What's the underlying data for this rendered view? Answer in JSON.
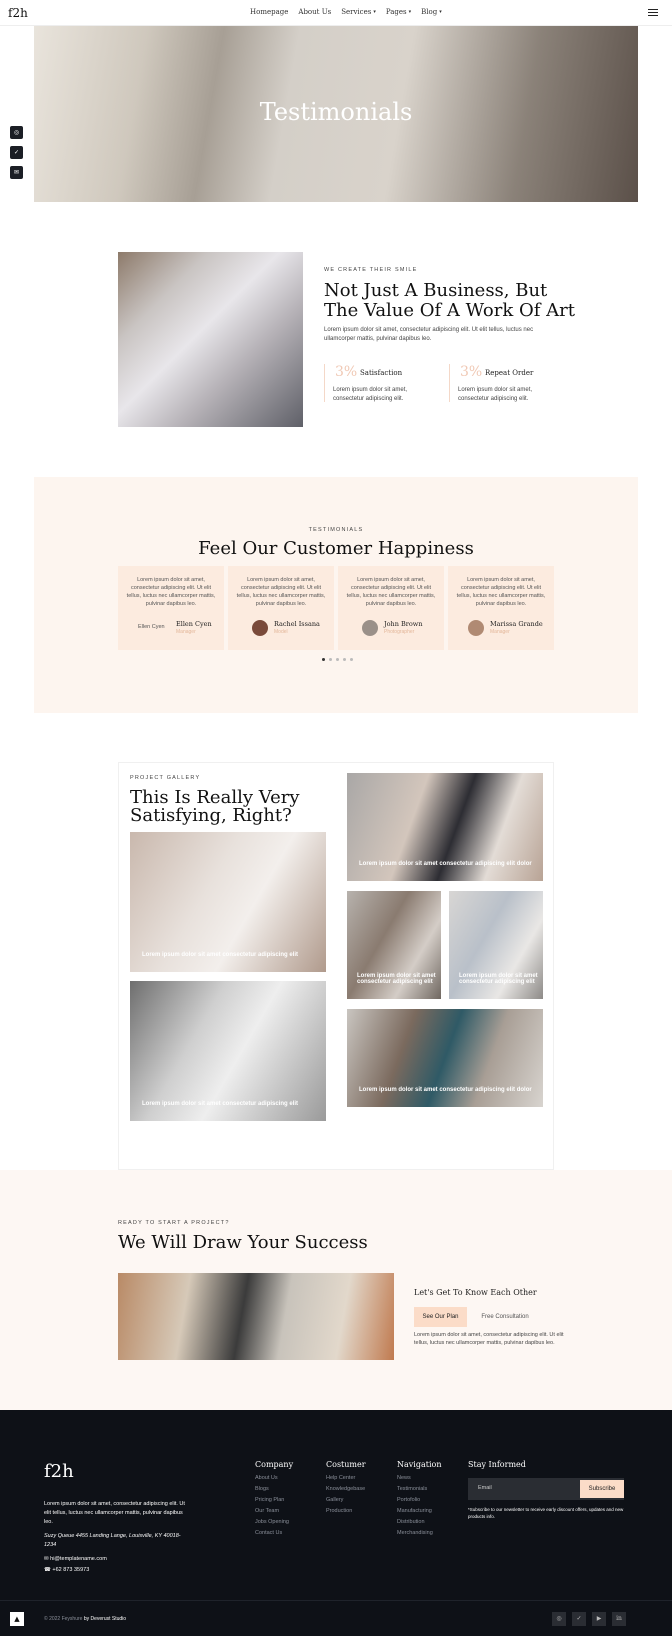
{
  "header": {
    "logo": "f2h",
    "nav": [
      "Homepage",
      "About Us",
      "Services",
      "Pages",
      "Blog"
    ],
    "nav_dropdown": [
      false,
      false,
      true,
      true,
      true
    ]
  },
  "hero": {
    "title": "Testimonials"
  },
  "about": {
    "kicker": "WE CREATE THEIR SMILE",
    "title_line1": "Not Just A Business, But",
    "title_line2": "The Value Of A Work Of Art",
    "text": "Lorem ipsum dolor sit amet, consectetur adipiscing elit. Ut elit tellus, luctus nec ullamcorper mattis, pulvinar dapibus leo.",
    "stats": [
      {
        "num": "3%",
        "label": "Satisfaction",
        "text": "Lorem ipsum dolor sit amet, consectetur adipiscing elit."
      },
      {
        "num": "3%",
        "label": "Repeat Order",
        "text": "Lorem ipsum dolor sit amet, consectetur adipiscing elit."
      }
    ]
  },
  "testimonials": {
    "kicker": "TESTIMONIALS",
    "title": "Feel Our Customer Happiness",
    "cards": [
      {
        "text": "Lorem ipsum dolor sit amet, consectetur adipiscing elit. Ut elit tellus, luctus nec ullamcorper mattis, pulvinar dapibus leo.",
        "name": "Ellen Cyen",
        "role": "Manager",
        "alt": "Ellen Cyen"
      },
      {
        "text": "Lorem ipsum dolor sit amet, consectetur adipiscing elit. Ut elit tellus, luctus nec ullamcorper mattis, pulvinar dapibus leo.",
        "name": "Rachel Issana",
        "role": "Model"
      },
      {
        "text": "Lorem ipsum dolor sit amet, consectetur adipiscing elit. Ut elit tellus, luctus nec ullamcorper mattis, pulvinar dapibus leo.",
        "name": "John Brown",
        "role": "Photographer"
      },
      {
        "text": "Lorem ipsum dolor sit amet, consectetur adipiscing elit. Ut elit tellus, luctus nec ullamcorper mattis, pulvinar dapibus leo.",
        "name": "Marissa Grande",
        "role": "Manager"
      }
    ]
  },
  "gallery": {
    "kicker": "PROJECT GALLERY",
    "title_line1": "This Is Really Very",
    "title_line2": "Satisfying, Right?",
    "caption": "Lorem ipsum dolor sit amet consectetur adipiscing elit dolor",
    "caption_short": "Lorem ipsum dolor sit amet consectetur adipiscing elit"
  },
  "cta": {
    "kicker": "READY TO START A PROJECT?",
    "title": "We Will Draw Your Success",
    "subtitle": "Let's Get To Know Each Other",
    "btn_plan": "See Our Plan",
    "btn_consult": "Free Consultation",
    "text": "Lorem ipsum dolor sit amet, consectetur adipiscing elit. Ut elit tellus, luctus nec ullamcorper mattis, pulvinar dapibus leo."
  },
  "footer": {
    "logo": "f2h",
    "about": "Lorem ipsum dolor sit amet, consectetur adipiscing elit. Ut elit tellus, luctus nec ullamcorper mattis, pulvinar dapibus leo.",
    "address": "Suzy Queue 4455 Landing Lange, Louisville, KY 40018-1234",
    "email": "hi@templatename.com",
    "phone": "+62 873 35973",
    "columns": [
      {
        "title": "Company",
        "links": [
          "About Us",
          "Blogs",
          "Pricing Plan",
          "Our Team",
          "Jobs Opening",
          "Contact Us"
        ]
      },
      {
        "title": "Costumer",
        "links": [
          "Help Center",
          "Knowledgebase",
          "Gallery",
          "Production"
        ]
      },
      {
        "title": "Navigation",
        "links": [
          "News",
          "Testimonials",
          "Portofolio",
          "Manufacturing",
          "Distribution",
          "Merchandising"
        ]
      }
    ],
    "newsletter_title": "Stay Informed",
    "email_placeholder": "Email",
    "subscribe": "Subscribe",
    "note": "*Subscribe to our newsletter to receive early discount offers, updates and new products info.",
    "copyright": "© 2022 Feyshure",
    "by": "by Deverust Studio"
  }
}
